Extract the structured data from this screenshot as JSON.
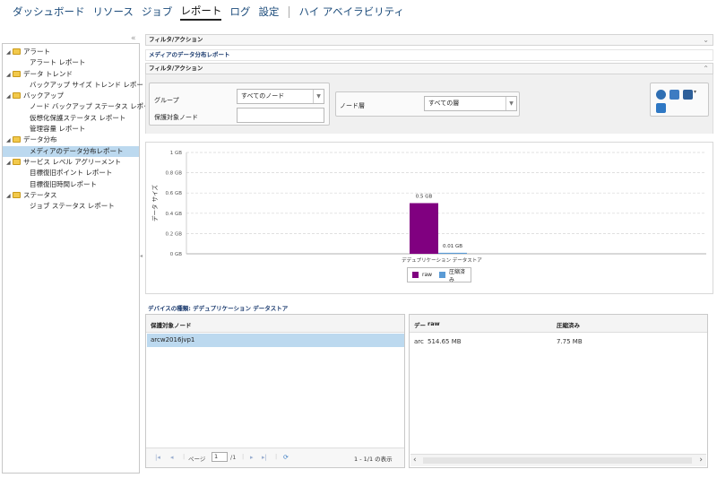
{
  "nav": {
    "items": [
      "ダッシュボード",
      "リソース",
      "ジョブ",
      "レポート",
      "ログ",
      "設定"
    ],
    "active_index": 3,
    "extra": "ハイ アベイラビリティ"
  },
  "sidebar": {
    "tree": [
      {
        "type": "folder",
        "label": "アラート"
      },
      {
        "type": "leaf",
        "label": "アラート レポート"
      },
      {
        "type": "folder",
        "label": "データ トレンド"
      },
      {
        "type": "leaf",
        "label": "バックアップ サイズ トレンド レポート"
      },
      {
        "type": "folder",
        "label": "バックアップ"
      },
      {
        "type": "leaf",
        "label": "ノード バックアップ ステータス レポート"
      },
      {
        "type": "leaf",
        "label": "仮想化保護ステータス レポート"
      },
      {
        "type": "leaf",
        "label": "管理容量 レポート"
      },
      {
        "type": "folder",
        "label": "データ分布"
      },
      {
        "type": "leaf",
        "label": "メディアのデータ分布レポート",
        "selected": true
      },
      {
        "type": "folder",
        "label": "サービス レベル アグリーメント"
      },
      {
        "type": "leaf",
        "label": "目標復旧ポイント レポート"
      },
      {
        "type": "leaf",
        "label": "目標復旧時間レポート"
      },
      {
        "type": "folder",
        "label": "ステータス"
      },
      {
        "type": "leaf",
        "label": "ジョブ ステータス レポート"
      }
    ]
  },
  "main": {
    "filter_bar": "フィルタ/アクション",
    "report_title": "メディアのデータ分布レポート",
    "filter_section": "フィルタ/アクション",
    "group_label": "グループ",
    "group_value": "すべてのノード",
    "protected_node_label": "保護対象ノード",
    "node_tier_label": "ノード層",
    "node_tier_value": "すべての層"
  },
  "chart_data": {
    "type": "bar",
    "categories": [
      "デデュプリケーション データストア"
    ],
    "series": [
      {
        "name": "raw",
        "values": [
          0.5
        ],
        "color": "#800080"
      },
      {
        "name": "圧縮済み",
        "values": [
          0.01
        ],
        "color": "#5b9bd5"
      }
    ],
    "data_labels": [
      "0.5 GB",
      "0.01 GB"
    ],
    "ylabel": "データ サイズ",
    "yticks": [
      "0 GB",
      "0.2 GB",
      "0.4 GB",
      "0.6 GB",
      "0.8 GB",
      "1 GB"
    ],
    "ylim": [
      0,
      1
    ],
    "grid": true,
    "legend": "bottom"
  },
  "detail": {
    "title": "デバイスの種類: デデュプリケーション データストア",
    "left_header": "保護対象ノード",
    "left_row": "arcw2016jvp1",
    "pager_page": "ページ",
    "pager_value": "1",
    "pager_of": "/1",
    "pager_count": "1 - 1/1 の表示",
    "right_headers": [
      "デー",
      "raw",
      "圧縮済み"
    ],
    "right_row": [
      "arc",
      "514.65 MB",
      "7.75 MB"
    ]
  }
}
